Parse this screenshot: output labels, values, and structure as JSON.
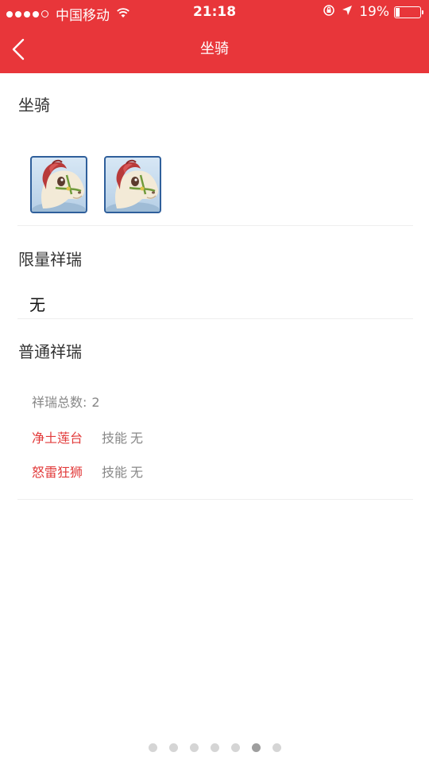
{
  "status_bar": {
    "carrier": "中国移动",
    "time": "21:18",
    "battery": "19%"
  },
  "nav": {
    "title": "坐骑",
    "back_icon": "chevron-left-icon"
  },
  "mount_section": {
    "title": "坐骑",
    "icons": [
      "horse-mount-icon",
      "horse-mount-icon"
    ]
  },
  "limited_section": {
    "title": "限量祥瑞",
    "value": "无"
  },
  "normal_section": {
    "title": "普通祥瑞",
    "total_label": "祥瑞总数:",
    "total_value": "2",
    "items": [
      {
        "name": "净土莲台",
        "skill_label": "技能",
        "skill_value": "无"
      },
      {
        "name": "怒雷狂狮",
        "skill_label": "技能",
        "skill_value": "无"
      }
    ]
  },
  "pager": {
    "count": 7,
    "active_index": 5
  },
  "colors": {
    "header": "#e8363a",
    "item_name": "#e23b3b",
    "icon_border": "#2f5f9b"
  }
}
